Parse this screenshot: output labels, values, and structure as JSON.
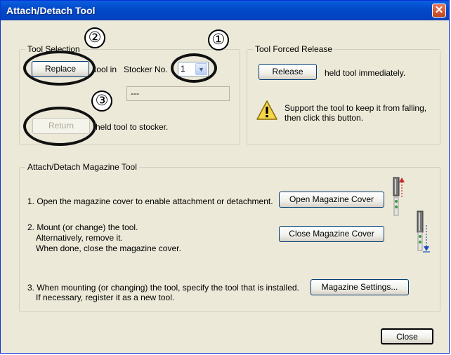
{
  "window": {
    "title": "Attach/Detach Tool",
    "close_glyph": "✕"
  },
  "tool_selection": {
    "legend": "Tool Selection",
    "replace_label": "Replace",
    "tool_in_text": "tool in",
    "stocker_label": "Stocker No.",
    "stocker_value": "1",
    "status_text": "---",
    "return_label": "Return",
    "return_text": "held tool to stocker."
  },
  "forced_release": {
    "legend": "Tool Forced Release",
    "release_label": "Release",
    "release_text": "held tool immediately.",
    "warning_line1": "Support the tool to keep it from falling,",
    "warning_line2": "then click this button."
  },
  "magazine": {
    "legend": "Attach/Detach Magazine Tool",
    "step1": "1. Open the magazine cover to enable attachment or detachment.",
    "open_label": "Open Magazine Cover",
    "step2_line1": "2. Mount (or change) the tool.",
    "step2_line2": "Alternatively, remove it.",
    "step2_line3": "When done, close the magazine cover.",
    "close_cover_label": "Close Magazine Cover",
    "step3_line1": "3. When mounting (or changing) the tool, specify the tool that is installed.",
    "step3_line2": "If necessary, register it as a new tool.",
    "settings_label": "Magazine Settings..."
  },
  "footer": {
    "close_label": "Close"
  },
  "callouts": [
    "①",
    "②",
    "③"
  ]
}
